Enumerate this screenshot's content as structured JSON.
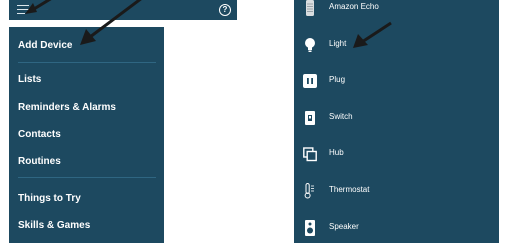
{
  "topbar": {
    "menu_icon": "hamburger-icon",
    "help_icon": "help-circle-icon",
    "help_glyph": "?"
  },
  "menu": {
    "items": [
      {
        "label": "Add Device"
      },
      {
        "label": "Lists"
      },
      {
        "label": "Reminders & Alarms"
      },
      {
        "label": "Contacts"
      },
      {
        "label": "Routines"
      },
      {
        "label": "Things to Try"
      },
      {
        "label": "Skills & Games"
      }
    ]
  },
  "devices": {
    "items": [
      {
        "label": "Amazon Echo",
        "icon": "echo-speaker-icon"
      },
      {
        "label": "Light",
        "icon": "light-bulb-icon"
      },
      {
        "label": "Plug",
        "icon": "plug-icon"
      },
      {
        "label": "Switch",
        "icon": "switch-icon"
      },
      {
        "label": "Hub",
        "icon": "hub-icon"
      },
      {
        "label": "Thermostat",
        "icon": "thermostat-icon"
      },
      {
        "label": "Speaker",
        "icon": "speaker-icon"
      }
    ]
  },
  "colors": {
    "panel": "#1d4960",
    "divider": "#2f6682",
    "text": "#ffffff",
    "annotation_arrow": "#1a1a1a"
  }
}
